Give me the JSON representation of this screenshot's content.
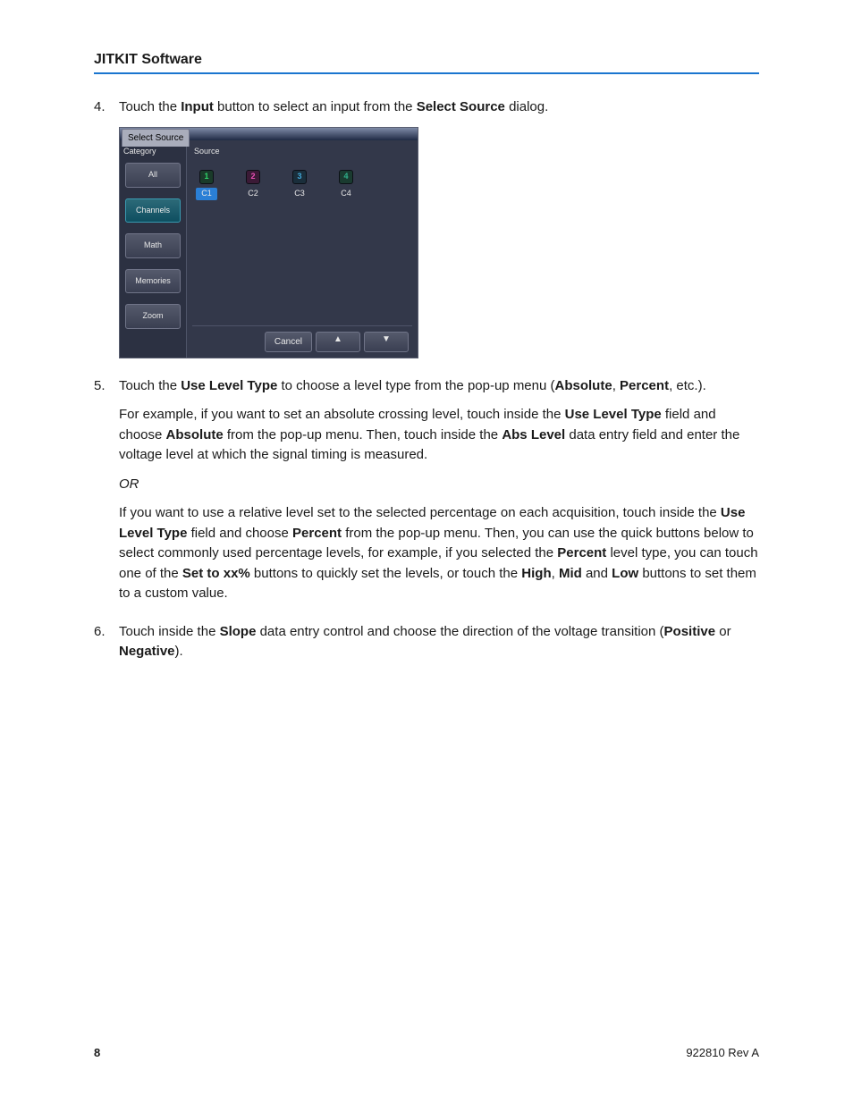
{
  "header": {
    "title": "JITKIT Software"
  },
  "steps": {
    "s4": {
      "num": "4.",
      "pre": "Touch the ",
      "b1": "Input",
      "mid": " button to select an input from the ",
      "b2": "Select Source",
      "post": " dialog."
    },
    "s5": {
      "num": "5.",
      "pre": "Touch the ",
      "b1": "Use Level Type",
      "mid": " to choose a level type from the pop-up menu (",
      "b2": "Absolute",
      "sep": ", ",
      "b3": "Percent",
      "post": ", etc.)."
    },
    "s5p1": {
      "t1": "For example, if you want to set an absolute crossing level, touch inside the ",
      "b1": "Use Level Type",
      "t2": " field and choose ",
      "b2": "Absolute",
      "t3": " from the pop-up menu. Then, touch inside the ",
      "b3": "Abs Level",
      "t4": " data entry field and enter the voltage level at which the signal timing is measured."
    },
    "s5or": "OR",
    "s5p2": {
      "t1": "If you want to use a relative level set to the selected percentage on each acquisition, touch inside the ",
      "b1": "Use Level Type",
      "t2": " field and choose ",
      "b2": "Percent",
      "t3": " from the pop-up menu. Then, you can use the quick buttons below to select commonly used percentage levels, for example, if you selected the ",
      "b3": "Percent",
      "t4": " level type, you can touch one of the ",
      "b4": "Set to xx%",
      "t5": " buttons to quickly set the levels, or touch the ",
      "b5": "High",
      "t6": ", ",
      "b6": "Mid",
      "t7": " and ",
      "b7": "Low",
      "t8": " buttons to set them to a custom value."
    },
    "s6": {
      "num": "6.",
      "pre": "Touch inside the ",
      "b1": "Slope",
      "mid": " data entry control and choose the direction of the voltage transition (",
      "b2": "Positive",
      "sep": " or ",
      "b3": "Negative",
      "post": ")."
    }
  },
  "dialog": {
    "tab": "Select Source",
    "category_title": "Category",
    "source_title": "Source",
    "categories": [
      {
        "label": "All",
        "active": false
      },
      {
        "label": "Channels",
        "active": true
      },
      {
        "label": "Math",
        "active": false
      },
      {
        "label": "Memories",
        "active": false
      },
      {
        "label": "Zoom",
        "active": false
      }
    ],
    "sources": [
      {
        "num": "1",
        "label": "C1",
        "icon_bg": "#1a3b2a",
        "icon_fg": "#2fd86b",
        "selected": true
      },
      {
        "num": "2",
        "label": "C2",
        "icon_bg": "#3b1a36",
        "icon_fg": "#e94fb4",
        "selected": false
      },
      {
        "num": "3",
        "label": "C3",
        "icon_bg": "#1a2e3b",
        "icon_fg": "#42a8d8",
        "selected": false
      },
      {
        "num": "4",
        "label": "C4",
        "icon_bg": "#1a3b30",
        "icon_fg": "#2fb08a",
        "selected": false
      }
    ],
    "cancel": "Cancel"
  },
  "footer": {
    "page": "8",
    "rev": "922810 Rev A"
  }
}
